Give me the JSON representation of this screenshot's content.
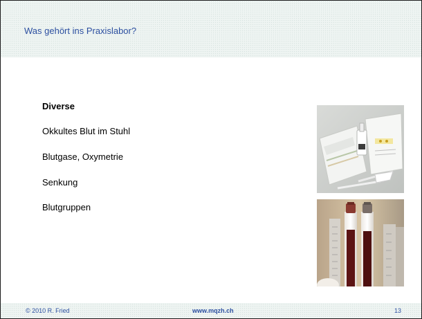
{
  "slide": {
    "title": "Was gehört ins Praxislabor?",
    "heading": "Diverse",
    "items": [
      "Okkultes Blut im Stuhl",
      "Blutgase, Oxymetrie",
      "Senkung",
      "Blutgruppen"
    ],
    "images": [
      {
        "icon": "test-kit-photo"
      },
      {
        "icon": "sedimentation-tubes-photo"
      }
    ]
  },
  "footer": {
    "copyright": "© 2010 R. Fried",
    "website": "www.mqzh.ch",
    "page_number": "13"
  }
}
